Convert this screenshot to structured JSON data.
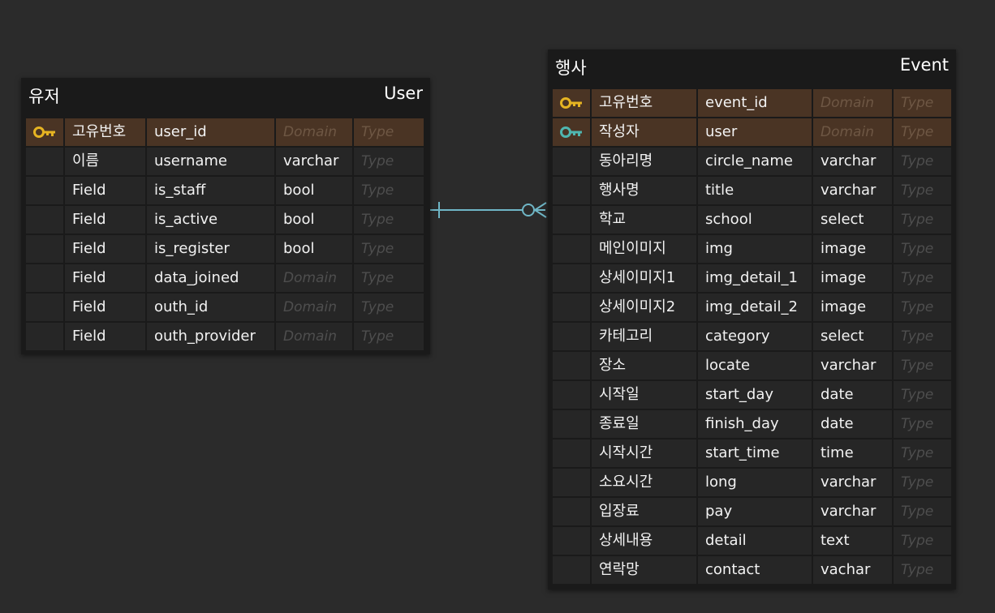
{
  "colors": {
    "canvas": "#2b2b2b",
    "entity_bg": "#1a1a1a",
    "row_bg": "#262626",
    "key_row_bg": "#4a3424",
    "primary_key_icon": "#e6b422",
    "foreign_key_icon": "#4fb6b0",
    "relationship_line": "#6fb6c6"
  },
  "entities": {
    "user": {
      "logical_name": "유저",
      "physical_name": "User",
      "rows": [
        {
          "key": "primary",
          "icon": "key-icon",
          "logical": "고유번호",
          "physical": "user_id",
          "type": "Domain",
          "type_placeholder": true,
          "extra": "Type"
        },
        {
          "key": "none",
          "icon": "",
          "logical": "이름",
          "physical": "username",
          "type": "varchar",
          "type_placeholder": false,
          "extra": "Type"
        },
        {
          "key": "none",
          "icon": "",
          "logical": "Field",
          "physical": "is_staff",
          "type": "bool",
          "type_placeholder": false,
          "extra": "Type"
        },
        {
          "key": "none",
          "icon": "",
          "logical": "Field",
          "physical": "is_active",
          "type": "bool",
          "type_placeholder": false,
          "extra": "Type"
        },
        {
          "key": "none",
          "icon": "",
          "logical": "Field",
          "physical": "is_register",
          "type": "bool",
          "type_placeholder": false,
          "extra": "Type"
        },
        {
          "key": "none",
          "icon": "",
          "logical": "Field",
          "physical": "data_joined",
          "type": "Domain",
          "type_placeholder": true,
          "extra": "Type"
        },
        {
          "key": "none",
          "icon": "",
          "logical": "Field",
          "physical": "outh_id",
          "type": "Domain",
          "type_placeholder": true,
          "extra": "Type"
        },
        {
          "key": "none",
          "icon": "",
          "logical": "Field",
          "physical": "outh_provider",
          "type": "Domain",
          "type_placeholder": true,
          "extra": "Type"
        }
      ]
    },
    "event": {
      "logical_name": "행사",
      "physical_name": "Event",
      "rows": [
        {
          "key": "primary",
          "icon": "key-icon",
          "logical": "고유번호",
          "physical": "event_id",
          "type": "Domain",
          "type_placeholder": true,
          "extra": "Type"
        },
        {
          "key": "foreign",
          "icon": "foreign-key-icon",
          "logical": "작성자",
          "physical": "user",
          "type": "Domain",
          "type_placeholder": true,
          "extra": "Type"
        },
        {
          "key": "none",
          "icon": "",
          "logical": "동아리명",
          "physical": "circle_name",
          "type": "varchar",
          "type_placeholder": false,
          "extra": "Type"
        },
        {
          "key": "none",
          "icon": "",
          "logical": "행사명",
          "physical": "title",
          "type": "varchar",
          "type_placeholder": false,
          "extra": "Type"
        },
        {
          "key": "none",
          "icon": "",
          "logical": "학교",
          "physical": "school",
          "type": "select",
          "type_placeholder": false,
          "extra": "Type"
        },
        {
          "key": "none",
          "icon": "",
          "logical": "메인이미지",
          "physical": "img",
          "type": "image",
          "type_placeholder": false,
          "extra": "Type"
        },
        {
          "key": "none",
          "icon": "",
          "logical": "상세이미지1",
          "physical": "img_detail_1",
          "type": "image",
          "type_placeholder": false,
          "extra": "Type"
        },
        {
          "key": "none",
          "icon": "",
          "logical": "상세이미지2",
          "physical": "img_detail_2",
          "type": "image",
          "type_placeholder": false,
          "extra": "Type"
        },
        {
          "key": "none",
          "icon": "",
          "logical": "카테고리",
          "physical": "category",
          "type": "select",
          "type_placeholder": false,
          "extra": "Type"
        },
        {
          "key": "none",
          "icon": "",
          "logical": "장소",
          "physical": "locate",
          "type": "varchar",
          "type_placeholder": false,
          "extra": "Type"
        },
        {
          "key": "none",
          "icon": "",
          "logical": "시작일",
          "physical": "start_day",
          "type": "date",
          "type_placeholder": false,
          "extra": "Type"
        },
        {
          "key": "none",
          "icon": "",
          "logical": "종료일",
          "physical": "finish_day",
          "type": "date",
          "type_placeholder": false,
          "extra": "Type"
        },
        {
          "key": "none",
          "icon": "",
          "logical": "시작시간",
          "physical": "start_time",
          "type": "time",
          "type_placeholder": false,
          "extra": "Type"
        },
        {
          "key": "none",
          "icon": "",
          "logical": "소요시간",
          "physical": "long",
          "type": "varchar",
          "type_placeholder": false,
          "extra": "Type"
        },
        {
          "key": "none",
          "icon": "",
          "logical": "입장료",
          "physical": "pay",
          "type": "varchar",
          "type_placeholder": false,
          "extra": "Type"
        },
        {
          "key": "none",
          "icon": "",
          "logical": "상세내용",
          "physical": "detail",
          "type": "text",
          "type_placeholder": false,
          "extra": "Type"
        },
        {
          "key": "none",
          "icon": "",
          "logical": "연락망",
          "physical": "contact",
          "type": "vachar",
          "type_placeholder": false,
          "extra": "Type"
        }
      ]
    }
  },
  "relationship": {
    "from": "User",
    "to": "Event",
    "from_cardinality": "exactly-one",
    "to_cardinality": "zero-or-many"
  }
}
